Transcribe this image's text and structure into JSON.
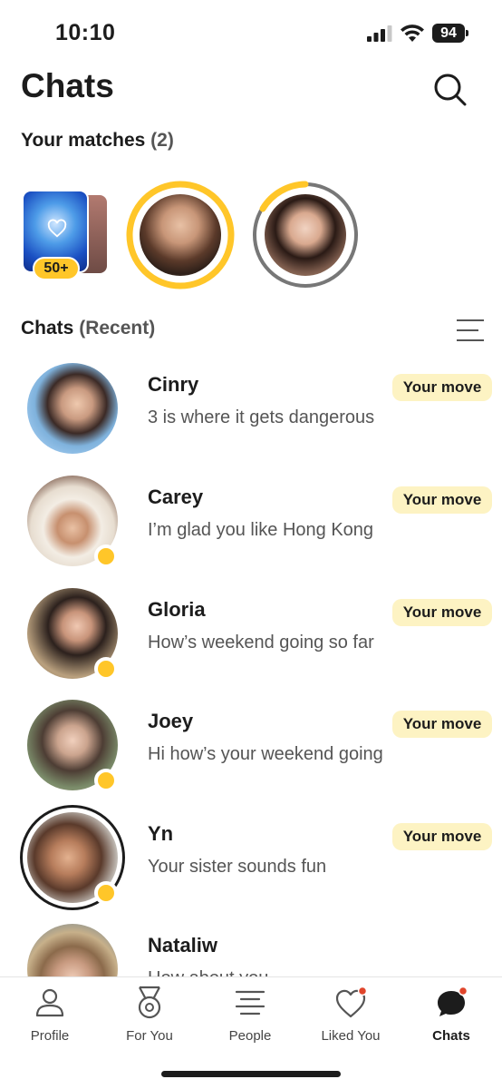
{
  "status_bar": {
    "time": "10:10",
    "battery": "94"
  },
  "header": {
    "title": "Chats",
    "search_icon": "search-icon"
  },
  "matches": {
    "heading": "Your matches",
    "count": "(2)",
    "likes_badge": "50+",
    "ring_color": "#ffc629"
  },
  "chats_section": {
    "heading": "Chats",
    "subheading": "(Recent)",
    "filter_icon": "filter-lines-icon"
  },
  "chats": [
    {
      "name": "Cinry",
      "message": "3 is where it gets dangerous",
      "tag": "Your move"
    },
    {
      "name": "Carey",
      "message": "I’m glad you like Hong Kong",
      "tag": "Your move"
    },
    {
      "name": "Gloria",
      "message": "How’s weekend going so far",
      "tag": "Your move"
    },
    {
      "name": "Joey",
      "message": "Hi how’s your weekend going",
      "tag": "Your move"
    },
    {
      "name": "Yn",
      "message": "Your sister sounds fun",
      "tag": "Your move"
    },
    {
      "name": "Nataliw",
      "message": "How about you"
    }
  ],
  "tabbar": {
    "profile": "Profile",
    "for_you": "For You",
    "people": "People",
    "liked_you": "Liked You",
    "chats": "Chats"
  },
  "colors": {
    "accent": "#ffc629",
    "tag_bg": "#fdf3c3",
    "notification": "#e0452b"
  }
}
